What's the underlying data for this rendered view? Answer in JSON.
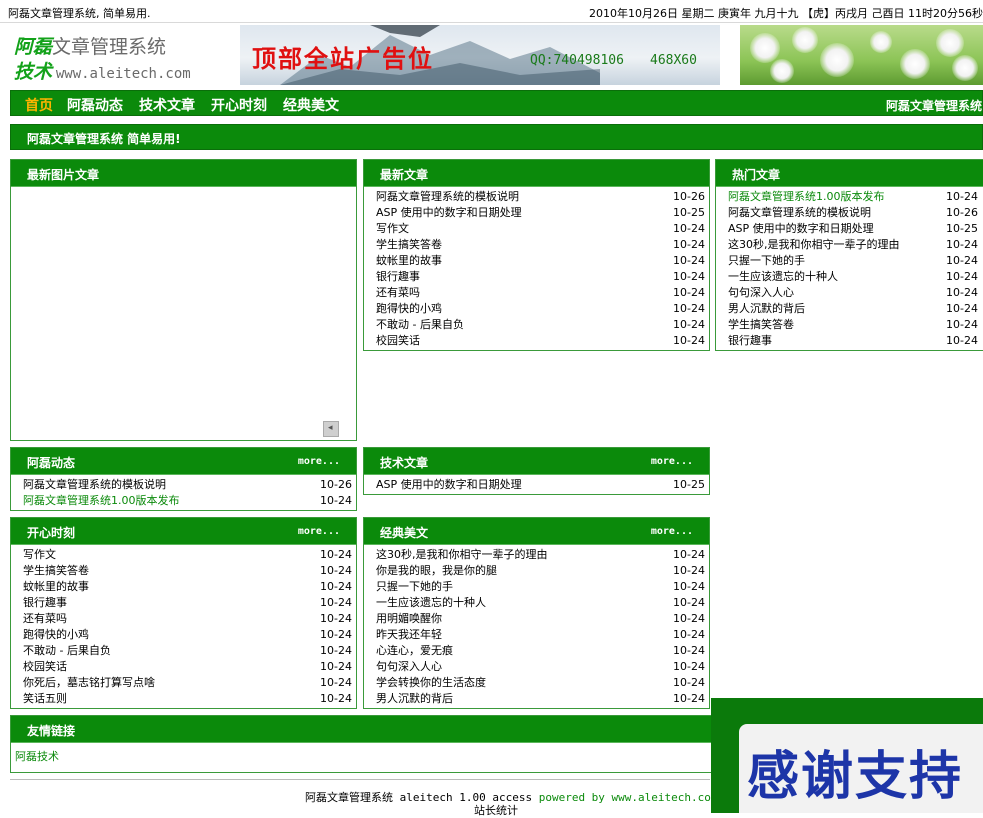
{
  "topbar": {
    "slogan": "阿磊文章管理系统, 简单易用.",
    "datetime": "2010年10月26日  星期二  庚寅年 九月十九 【虎】丙戌月 己酉日 11时20分56秒"
  },
  "logo": {
    "line1_green": "阿磊",
    "line1_gray": "文章管理系统",
    "line2_green": "技术",
    "line2_url": "www.aleitech.com"
  },
  "banner": {
    "title": "顶部全站广告位",
    "qq": "QQ:740498106",
    "size": "468X60"
  },
  "nav": {
    "items": [
      "首页",
      "阿磊动态",
      "技术文章",
      "开心时刻",
      "经典美文"
    ],
    "right": "阿磊文章管理系统"
  },
  "notice": "阿磊文章管理系统 简单易用!",
  "more_label": "more...",
  "boxes": {
    "pic": {
      "title": "最新图片文章",
      "scroll_glyph": "◂"
    },
    "latest": {
      "title": "最新文章",
      "items": [
        {
          "t": "阿磊文章管理系统的模板说明",
          "d": "10-26"
        },
        {
          "t": "ASP 使用中的数字和日期处理",
          "d": "10-25"
        },
        {
          "t": "写作文",
          "d": "10-24"
        },
        {
          "t": "学生搞笑答卷",
          "d": "10-24"
        },
        {
          "t": "蚊帐里的故事",
          "d": "10-24"
        },
        {
          "t": "银行趣事",
          "d": "10-24"
        },
        {
          "t": "还有菜吗",
          "d": "10-24"
        },
        {
          "t": "跑得快的小鸡",
          "d": "10-24"
        },
        {
          "t": "不敢动 - 后果自负",
          "d": "10-24"
        },
        {
          "t": "校园笑话",
          "d": "10-24"
        }
      ]
    },
    "hot": {
      "title": "热门文章",
      "items": [
        {
          "t": "阿磊文章管理系统1.00版本发布",
          "d": "10-24"
        },
        {
          "t": "阿磊文章管理系统的模板说明",
          "d": "10-26"
        },
        {
          "t": "ASP 使用中的数字和日期处理",
          "d": "10-25"
        },
        {
          "t": "这30秒,是我和你相守一辈子的理由",
          "d": "10-24"
        },
        {
          "t": "只握一下她的手",
          "d": "10-24"
        },
        {
          "t": "一生应该遗忘的十种人",
          "d": "10-24"
        },
        {
          "t": "句句深入人心",
          "d": "10-24"
        },
        {
          "t": "男人沉默的背后",
          "d": "10-24"
        },
        {
          "t": "学生搞笑答卷",
          "d": "10-24"
        },
        {
          "t": "银行趣事",
          "d": "10-24"
        }
      ]
    },
    "news": {
      "title": "阿磊动态",
      "items": [
        {
          "t": "阿磊文章管理系统的模板说明",
          "d": "10-26"
        },
        {
          "t": "阿磊文章管理系统1.00版本发布",
          "d": "10-24"
        }
      ]
    },
    "tech": {
      "title": "技术文章",
      "items": [
        {
          "t": "ASP 使用中的数字和日期处理",
          "d": "10-25"
        }
      ]
    },
    "fun": {
      "title": "开心时刻",
      "items": [
        {
          "t": "写作文",
          "d": "10-24"
        },
        {
          "t": "学生搞笑答卷",
          "d": "10-24"
        },
        {
          "t": "蚊帐里的故事",
          "d": "10-24"
        },
        {
          "t": "银行趣事",
          "d": "10-24"
        },
        {
          "t": "还有菜吗",
          "d": "10-24"
        },
        {
          "t": "跑得快的小鸡",
          "d": "10-24"
        },
        {
          "t": "不敢动 - 后果自负",
          "d": "10-24"
        },
        {
          "t": "校园笑话",
          "d": "10-24"
        },
        {
          "t": "你死后，墓志铭打算写点啥",
          "d": "10-24"
        },
        {
          "t": "笑话五则",
          "d": "10-24"
        }
      ]
    },
    "classic": {
      "title": "经典美文",
      "items": [
        {
          "t": "这30秒,是我和你相守一辈子的理由",
          "d": "10-24"
        },
        {
          "t": "你是我的眼，我是你的腿",
          "d": "10-24"
        },
        {
          "t": "只握一下她的手",
          "d": "10-24"
        },
        {
          "t": "一生应该遗忘的十种人",
          "d": "10-24"
        },
        {
          "t": "用明媚唤醒你",
          "d": "10-24"
        },
        {
          "t": "昨天我还年轻",
          "d": "10-24"
        },
        {
          "t": "心连心，爱无痕",
          "d": "10-24"
        },
        {
          "t": "句句深入人心",
          "d": "10-24"
        },
        {
          "t": "学会转换你的生活态度",
          "d": "10-24"
        },
        {
          "t": "男人沉默的背后",
          "d": "10-24"
        }
      ]
    },
    "links": {
      "title": "友情链接",
      "items": [
        "阿磊技术"
      ]
    }
  },
  "footer": {
    "line1_a": "阿磊文章管理系统 aleitech 1.00 access ",
    "line1_b": "powered by www.aleitech.com",
    "stats": "站长统计"
  },
  "float_ad": {
    "text": "感谢支持"
  },
  "colors": {
    "brand_green": "#0b8a0b",
    "nav_active": "#ffb400",
    "banner_red": "#e01010"
  }
}
